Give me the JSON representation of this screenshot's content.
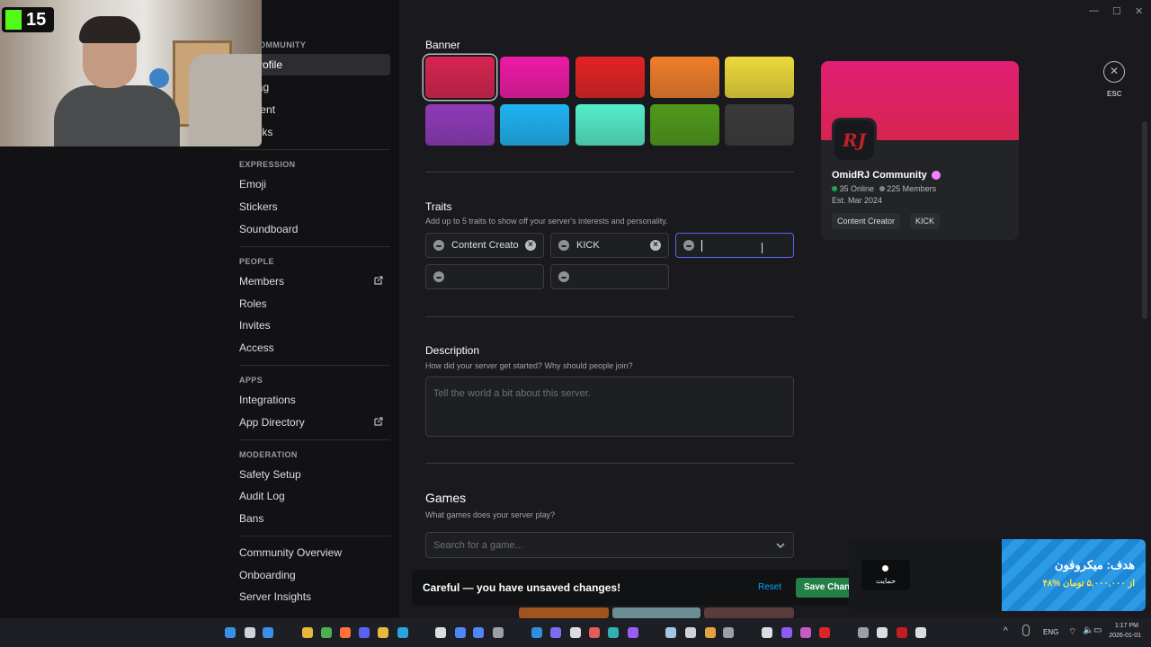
{
  "window": {
    "minimize": "—",
    "maximize": "☐",
    "close": "✕"
  },
  "sidebar": {
    "community_header": "RJ COMMUNITY",
    "top_items": [
      {
        "label": "er Profile",
        "active": true
      },
      {
        "label": "er Tag"
      },
      {
        "label": "gement"
      },
      {
        "label": "t Perks"
      }
    ],
    "sections": [
      {
        "title": "EXPRESSION",
        "items": [
          "Emoji",
          "Stickers",
          "Soundboard"
        ]
      },
      {
        "title": "PEOPLE",
        "items": [
          "Members",
          "Roles",
          "Invites",
          "Access"
        ]
      },
      {
        "title": "APPS",
        "items": [
          "Integrations",
          "App Directory"
        ]
      },
      {
        "title": "MODERATION",
        "items": [
          "Safety Setup",
          "Audit Log",
          "Bans"
        ]
      }
    ],
    "extra_items": [
      "Community Overview",
      "Onboarding",
      "Server Insights"
    ]
  },
  "main": {
    "banner": {
      "title": "Banner",
      "colors": [
        "#d6244f",
        "#ee1aa5",
        "#e32222",
        "#ef7e2a",
        "#ebd93a",
        "#8f3ab8",
        "#1fb3f2",
        "#54edc8",
        "#4f9a19",
        "#3a3a3a"
      ],
      "selected_index": 0
    },
    "traits": {
      "title": "Traits",
      "subtitle": "Add up to 5 traits to show off your server's interests and personality.",
      "values": [
        "Content Creato",
        "KICK",
        "",
        "",
        ""
      ]
    },
    "description": {
      "title": "Description",
      "subtitle": "How did your server get started? Why should people join?",
      "placeholder": "Tell the world a bit about this server."
    },
    "games": {
      "title": "Games",
      "subtitle": "What games does your server play?",
      "placeholder": "Search for a game..."
    }
  },
  "preview": {
    "server_name": "OmidRJ Community",
    "online": "35 Online",
    "members": "225 Members",
    "established": "Est. Mar 2024",
    "tags": [
      "Content Creator",
      "KICK"
    ],
    "avatar_text": "RJ",
    "colors": {
      "banner": "#d6244f",
      "online": "#23a55a"
    }
  },
  "esc": {
    "label": "ESC"
  },
  "unsaved_bar": {
    "message": "Careful — you have unsaved changes!",
    "reset": "Reset",
    "save": "Save Chang"
  },
  "overlay": {
    "kick_count": "15",
    "donate_button": "حمایت",
    "goal_title": "هدف: میکروفون",
    "goal_sub": "۴۸% از ۵,۰۰۰,۰۰۰ تومان",
    "goal_progress": 0.48
  },
  "taskbar": {
    "lang": "ENG",
    "time": "1:17 PM",
    "date": "2026-01-01"
  },
  "colors": {
    "accent": "#5865f2",
    "save": "#248046",
    "reset": "#00a8fc"
  }
}
